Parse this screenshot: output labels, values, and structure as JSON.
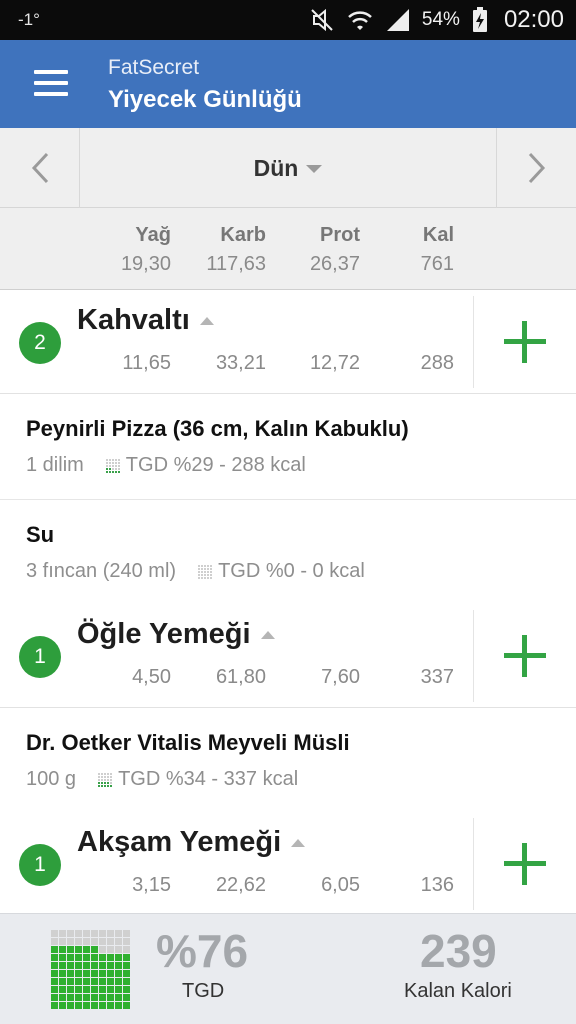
{
  "status_bar": {
    "left_indicator": "-1°",
    "battery_percent": "54%",
    "time": "02:00",
    "icons": [
      "mute-icon",
      "wifi-icon",
      "signal-icon",
      "battery-charging-icon"
    ]
  },
  "app_bar": {
    "menu_icon": "hamburger-menu-icon",
    "title": "FatSecret",
    "subtitle": "Yiyecek Günlüğü"
  },
  "date_nav": {
    "prev_icon": "chevron-left-icon",
    "date_label": "Dün",
    "next_icon": "chevron-right-icon"
  },
  "totals": {
    "headers": {
      "fat": "Yağ",
      "carb": "Karb",
      "prot": "Prot",
      "cal": "Kal"
    },
    "values": {
      "fat": "19,30",
      "carb": "117,63",
      "prot": "26,37",
      "cal": "761"
    }
  },
  "meals": [
    {
      "count": "2",
      "name": "Kahvaltı",
      "fat": "11,65",
      "carb": "33,21",
      "prot": "12,72",
      "cal": "288",
      "items": [
        {
          "name": "Peynirli Pizza (36 cm, Kalın Kabuklu)",
          "qty": "1  dilim",
          "rdi": "TGD %29 - 288 kcal",
          "rdi_fraction": 0.29
        },
        {
          "name": "Su",
          "qty": "3  fıncan (240 ml)",
          "rdi": "TGD %0 - 0 kcal",
          "rdi_fraction": 0
        }
      ]
    },
    {
      "count": "1",
      "name": "Öğle Yemeği",
      "fat": "4,50",
      "carb": "61,80",
      "prot": "7,60",
      "cal": "337",
      "items": [
        {
          "name": "Dr. Oetker Vitalis Meyveli Müsli",
          "qty": "100  g",
          "rdi": "TGD %34 - 337 kcal",
          "rdi_fraction": 0.34
        }
      ]
    },
    {
      "count": "1",
      "name": "Akşam Yemeği",
      "fat": "3,15",
      "carb": "22,62",
      "prot": "6,05",
      "cal": "136",
      "items": []
    }
  ],
  "footer": {
    "rdi_value": "%76",
    "rdi_label": "TGD",
    "rdi_fraction": 0.76,
    "remaining_value": "239",
    "remaining_label": "Kalan Kalori"
  },
  "colors": {
    "app_bar": "#3f73bd",
    "accent_green": "#33a444",
    "badge_green": "#2e9e3c"
  }
}
